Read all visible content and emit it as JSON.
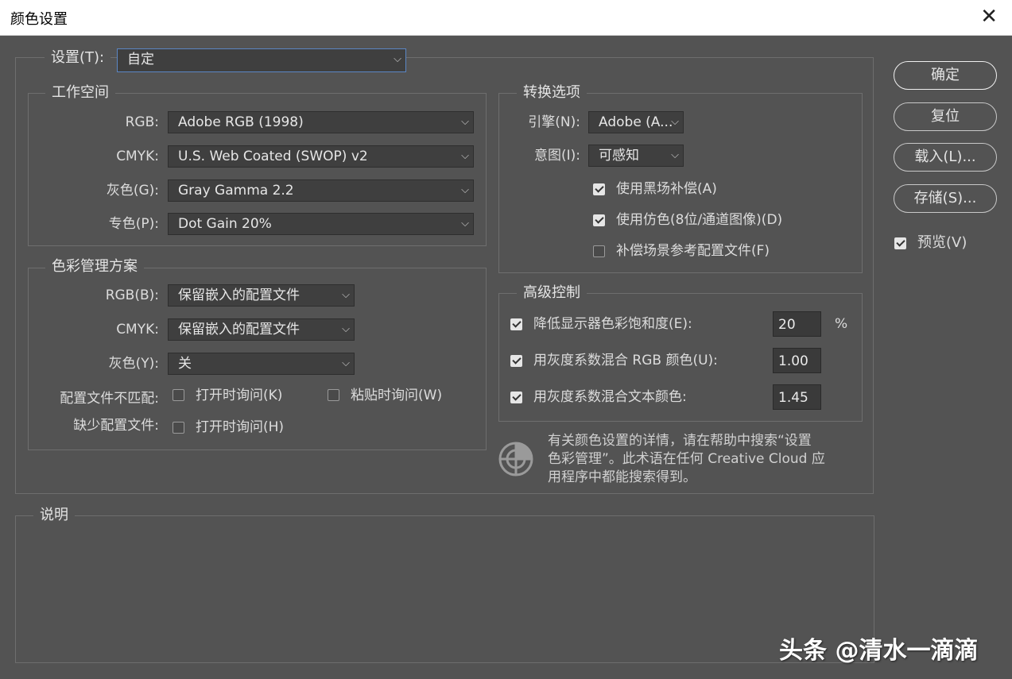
{
  "window": {
    "title": "颜色设置",
    "close_glyph": "✕"
  },
  "settings": {
    "label": "设置(T):",
    "value": "自定"
  },
  "working_spaces": {
    "legend": "工作空间",
    "rows": [
      {
        "label": "RGB:",
        "value": "Adobe RGB (1998)"
      },
      {
        "label": "CMYK:",
        "value": "U.S. Web Coated (SWOP) v2"
      },
      {
        "label": "灰色(G):",
        "value": "Gray Gamma 2.2"
      },
      {
        "label": "专色(P):",
        "value": "Dot Gain 20%"
      }
    ]
  },
  "policies": {
    "legend": "色彩管理方案",
    "rows": [
      {
        "label": "RGB(B):",
        "value": "保留嵌入的配置文件"
      },
      {
        "label": "CMYK:",
        "value": "保留嵌入的配置文件"
      },
      {
        "label": "灰色(Y):",
        "value": "关"
      }
    ],
    "mismatch_label": "配置文件不匹配:",
    "mismatch_open": "打开时询问(K)",
    "mismatch_paste": "粘贴时询问(W)",
    "missing_label": "缺少配置文件:",
    "missing_open": "打开时询问(H)"
  },
  "conversion": {
    "legend": "转换选项",
    "engine_label": "引擎(N):",
    "engine_value": "Adobe (A...",
    "intent_label": "意图(I):",
    "intent_value": "可感知",
    "black_point": "使用黑场补偿(A)",
    "dither": "使用仿色(8位/通道图像)(D)",
    "compensate": "补偿场景参考配置文件(F)"
  },
  "advanced": {
    "legend": "高级控制",
    "desaturate_label": "降低显示器色彩饱和度(E):",
    "desaturate_value": "20",
    "desaturate_unit": "%",
    "blend_rgb_label": "用灰度系数混合 RGB 颜色(U):",
    "blend_rgb_value": "1.00",
    "blend_text_label": "用灰度系数混合文本颜色:",
    "blend_text_value": "1.45"
  },
  "help": {
    "line1": "有关颜色设置的详情，请在帮助中搜索“设置",
    "line2": "色彩管理”。此术语在任何 Creative Cloud 应",
    "line3": "用程序中都能搜索得到。"
  },
  "description": {
    "legend": "说明"
  },
  "buttons": {
    "ok": "确定",
    "reset": "复位",
    "load": "载入(L)...",
    "save": "存储(S)..."
  },
  "preview": {
    "label": "预览(V)",
    "checked": true
  },
  "checks": {
    "mismatch_open": false,
    "mismatch_paste": false,
    "missing_open": false,
    "black_point": true,
    "dither": true,
    "compensate": false,
    "desaturate": true,
    "blend_rgb": true,
    "blend_text": true
  },
  "watermark": "头条 @清水一滴滴",
  "icons": {
    "help": "color-wheel-icon",
    "dropdown": "chevron-down-icon"
  }
}
